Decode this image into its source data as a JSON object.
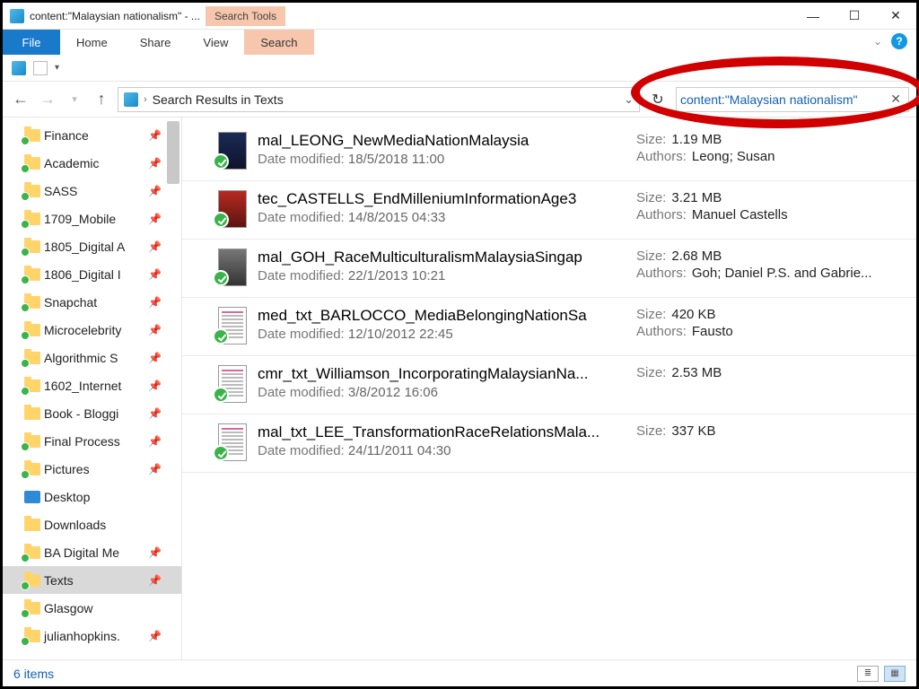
{
  "titlebar": {
    "title": "content:\"Malaysian nationalism\" - ...",
    "search_tools": "Search Tools"
  },
  "ribbon": {
    "file": "File",
    "home": "Home",
    "share": "Share",
    "view": "View",
    "search": "Search"
  },
  "address": {
    "location": "Search Results in Texts"
  },
  "search": {
    "query": "content:\"Malaysian nationalism\""
  },
  "tree": {
    "items": [
      {
        "label": "Finance",
        "icon": "folder-sync",
        "pinned": true
      },
      {
        "label": "Academic",
        "icon": "folder-sync",
        "pinned": true
      },
      {
        "label": "SASS",
        "icon": "folder-sync",
        "pinned": true
      },
      {
        "label": "1709_Mobile",
        "icon": "folder-sync",
        "pinned": true
      },
      {
        "label": "1805_Digital A",
        "icon": "folder-sync",
        "pinned": true
      },
      {
        "label": "1806_Digital I",
        "icon": "folder-sync",
        "pinned": true
      },
      {
        "label": "Snapchat",
        "icon": "folder-sync",
        "pinned": true
      },
      {
        "label": "Microcelebrity",
        "icon": "folder-sync",
        "pinned": true
      },
      {
        "label": "Algorithmic S",
        "icon": "folder-sync",
        "pinned": true
      },
      {
        "label": "1602_Internet",
        "icon": "folder-sync",
        "pinned": true
      },
      {
        "label": "Book - Bloggi",
        "icon": "folder",
        "pinned": true
      },
      {
        "label": "Final Process",
        "icon": "folder-sync",
        "pinned": true
      },
      {
        "label": "Pictures",
        "icon": "folder-sync",
        "pinned": true
      },
      {
        "label": "Desktop",
        "icon": "desktop",
        "pinned": false
      },
      {
        "label": "Downloads",
        "icon": "folder",
        "pinned": false
      },
      {
        "label": "BA Digital Me",
        "icon": "folder-sync",
        "pinned": true
      },
      {
        "label": "Texts",
        "icon": "folder-sync",
        "pinned": true,
        "selected": true
      },
      {
        "label": "Glasgow",
        "icon": "folder-sync",
        "pinned": false
      },
      {
        "label": "julianhopkins.",
        "icon": "folder-sync",
        "pinned": true
      }
    ]
  },
  "labels": {
    "date_modified": "Date modified:",
    "size": "Size:",
    "authors": "Authors:"
  },
  "results": [
    {
      "thumb": "dark",
      "name": "mal_LEONG_NewMediaNationMalaysia",
      "date": "18/5/2018 11:00",
      "size": "1.19 MB",
      "authors": "Leong; Susan"
    },
    {
      "thumb": "red",
      "name": "tec_CASTELLS_EndMilleniumInformationAge3",
      "date": "14/8/2015 04:33",
      "size": "3.21 MB",
      "authors": "Manuel Castells"
    },
    {
      "thumb": "dgrey",
      "name": "mal_GOH_RaceMulticulturalismMalaysiaSingap",
      "date": "22/1/2013 10:21",
      "size": "2.68 MB",
      "authors": "Goh; Daniel P.S. and Gabrie..."
    },
    {
      "thumb": "doc",
      "name": "med_txt_BARLOCCO_MediaBelongingNationSa",
      "date": "12/10/2012 22:45",
      "size": "420 KB",
      "authors": "Fausto"
    },
    {
      "thumb": "doc",
      "name": "cmr_txt_Williamson_IncorporatingMalaysianNa...",
      "date": "3/8/2012 16:06",
      "size": "2.53 MB",
      "authors": ""
    },
    {
      "thumb": "doc",
      "name": "mal_txt_LEE_TransformationRaceRelationsMala...",
      "date": "24/11/2011 04:30",
      "size": "337 KB",
      "authors": ""
    }
  ],
  "status": {
    "count": "6 items"
  }
}
